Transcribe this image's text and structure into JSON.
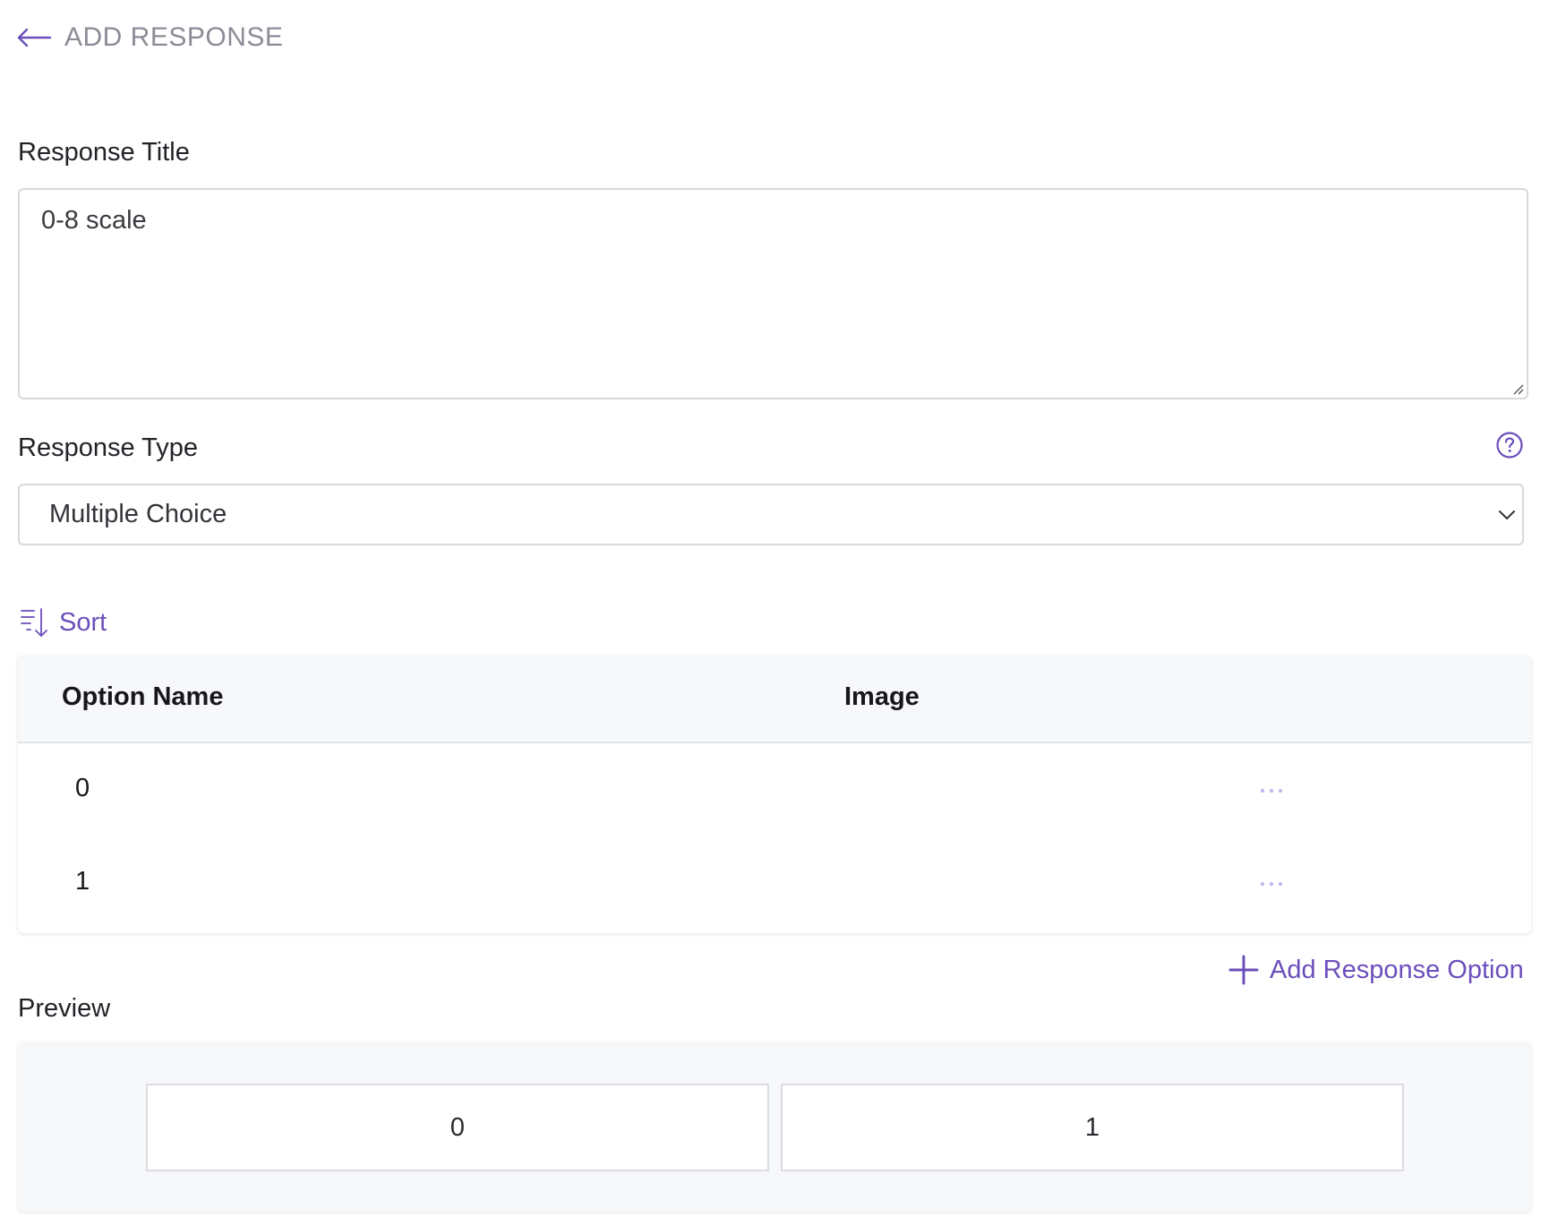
{
  "header": {
    "back_icon": "arrow-left-icon",
    "title": "ADD RESPONSE"
  },
  "colors": {
    "accent": "#6b4fbb",
    "header_text": "#8c8c97",
    "border": "#d8d8dd",
    "panel_bg": "#f7f8fa"
  },
  "form": {
    "title_label": "Response Title",
    "title_value": "0-8 scale",
    "type_label": "Response Type",
    "type_value": "Multiple Choice",
    "help_icon": "question-circle-icon"
  },
  "sort": {
    "label": "Sort",
    "icon": "sort-descending-icon"
  },
  "table": {
    "columns": [
      "Option Name",
      "Image"
    ],
    "rows": [
      {
        "name": "0",
        "menu_icon": "more-horizontal-icon"
      },
      {
        "name": "1",
        "menu_icon": "more-horizontal-icon"
      }
    ]
  },
  "add_option": {
    "label": "Add Response Option",
    "icon": "plus-icon"
  },
  "preview": {
    "label": "Preview",
    "options": [
      "0",
      "1"
    ]
  }
}
